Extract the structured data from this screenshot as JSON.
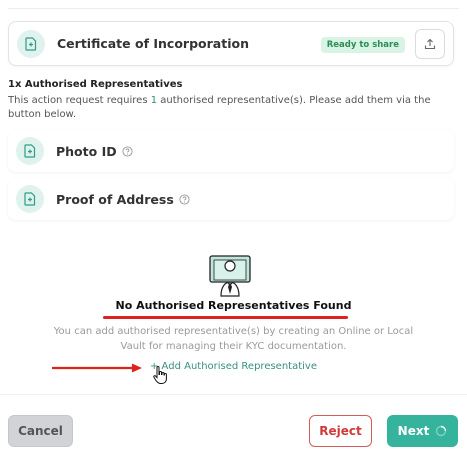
{
  "documents": {
    "certificate": {
      "title": "Certificate of Incorporation",
      "status": "Ready to share",
      "icon": "document-icon",
      "share_icon": "upload-icon"
    },
    "photo_id": {
      "title": "Photo ID",
      "icon": "document-icon",
      "help_icon": "help-circle-icon"
    },
    "proof_of_address": {
      "title": "Proof of Address",
      "icon": "document-icon",
      "help_icon": "help-circle-icon"
    }
  },
  "representatives": {
    "heading": "1x Authorised Representatives",
    "desc_before": "This action request requires ",
    "required_count": "1",
    "desc_after": " authorised representative(s). Please add them via the button below."
  },
  "empty_state": {
    "icon": "representative-illustration-icon",
    "title": "No Authorised Representatives Found",
    "description": "You can add authorised representative(s) by creating an Online or Local Vault for managing their KYC documentation.",
    "add_link": "+ Add Authorised Representative"
  },
  "footer": {
    "cancel": "Cancel",
    "reject": "Reject",
    "next": "Next"
  },
  "colors": {
    "accent": "#36b39c",
    "badge_bg": "#d9f3e4",
    "badge_text": "#2b8d57",
    "reject": "#d03a3a",
    "annotation_red": "#e0221f"
  }
}
